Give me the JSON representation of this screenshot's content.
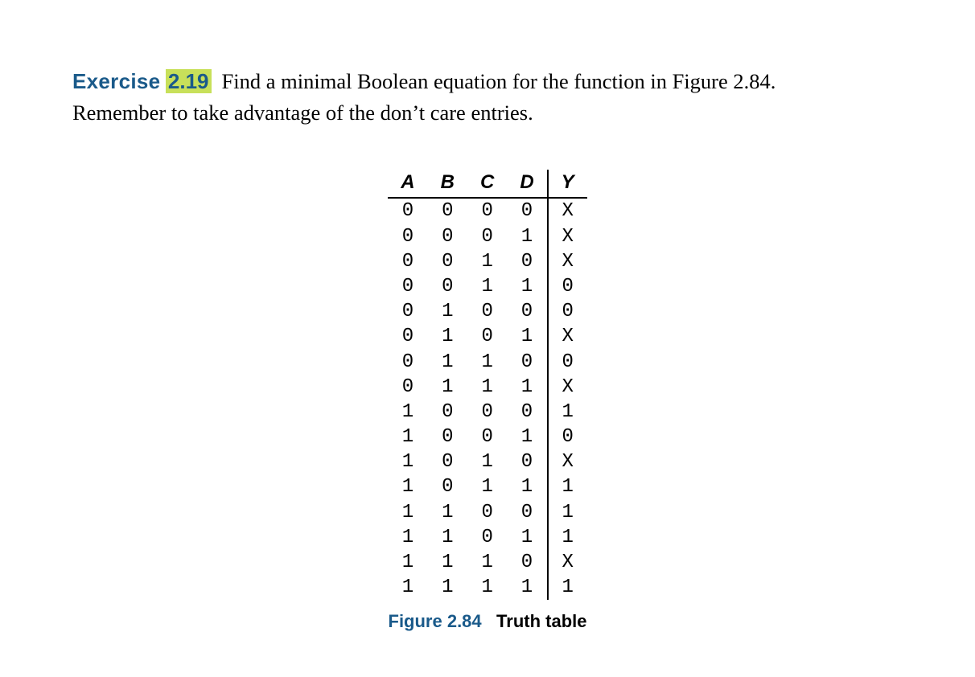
{
  "exercise": {
    "label": "Exercise",
    "number": "2.19",
    "text_line1": "Find a minimal Boolean equation for the function in Figure 2.84.",
    "text_line2": "Remember to take advantage of the don’t care entries."
  },
  "truth_table": {
    "headers": [
      "A",
      "B",
      "C",
      "D",
      "Y"
    ],
    "rows": [
      [
        "0",
        "0",
        "0",
        "0",
        "X"
      ],
      [
        "0",
        "0",
        "0",
        "1",
        "X"
      ],
      [
        "0",
        "0",
        "1",
        "0",
        "X"
      ],
      [
        "0",
        "0",
        "1",
        "1",
        "0"
      ],
      [
        "0",
        "1",
        "0",
        "0",
        "0"
      ],
      [
        "0",
        "1",
        "0",
        "1",
        "X"
      ],
      [
        "0",
        "1",
        "1",
        "0",
        "0"
      ],
      [
        "0",
        "1",
        "1",
        "1",
        "X"
      ],
      [
        "1",
        "0",
        "0",
        "0",
        "1"
      ],
      [
        "1",
        "0",
        "0",
        "1",
        "0"
      ],
      [
        "1",
        "0",
        "1",
        "0",
        "X"
      ],
      [
        "1",
        "0",
        "1",
        "1",
        "1"
      ],
      [
        "1",
        "1",
        "0",
        "0",
        "1"
      ],
      [
        "1",
        "1",
        "0",
        "1",
        "1"
      ],
      [
        "1",
        "1",
        "1",
        "0",
        "X"
      ],
      [
        "1",
        "1",
        "1",
        "1",
        "1"
      ]
    ]
  },
  "caption": {
    "label": "Figure 2.84",
    "title": "Truth table"
  }
}
